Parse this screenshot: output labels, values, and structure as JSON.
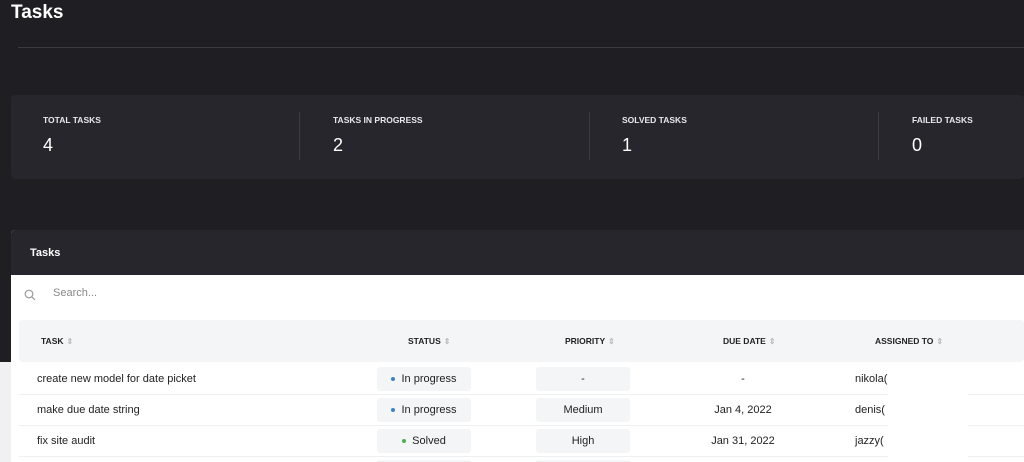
{
  "page": {
    "title": "Tasks"
  },
  "stats": [
    {
      "label": "TOTAL TASKS",
      "value": "4"
    },
    {
      "label": "TASKS IN PROGRESS",
      "value": "2"
    },
    {
      "label": "SOLVED TASKS",
      "value": "1"
    },
    {
      "label": "FAILED TASKS",
      "value": "0"
    }
  ],
  "table": {
    "title": "Tasks",
    "search_placeholder": "Search...",
    "columns": [
      "TASK",
      "STATUS",
      "PRIORITY",
      "DUE DATE",
      "ASSIGNED TO"
    ],
    "rows": [
      {
        "task": "create new model for date picket",
        "status": "In progress",
        "priority": "-",
        "due": "-",
        "assigned": "nikola("
      },
      {
        "task": "make due date string",
        "status": "In progress",
        "priority": "Medium",
        "due": "Jan 4, 2022",
        "assigned": "denis("
      },
      {
        "task": "fix site audit",
        "status": "Solved",
        "priority": "High",
        "due": "Jan 31, 2022",
        "assigned": "jazzy("
      }
    ]
  },
  "colors": {
    "in_progress": "#3b82c4",
    "solved": "#4caf50"
  }
}
